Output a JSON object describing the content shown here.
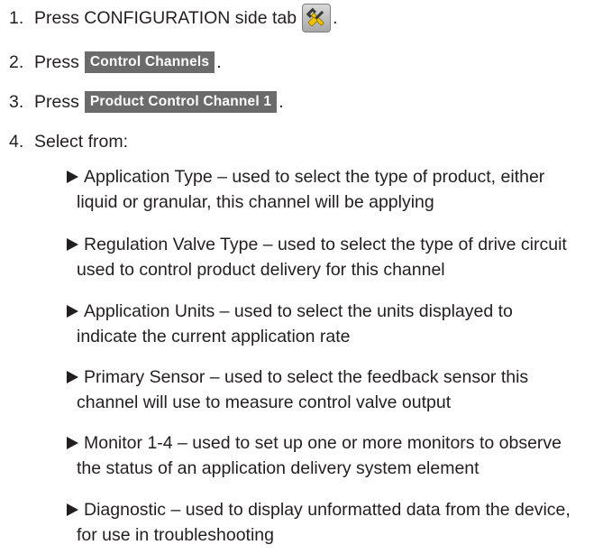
{
  "steps": [
    {
      "num": "1.",
      "text": "Press CONFIGURATION side tab",
      "icon": "configuration-tools-icon",
      "after": "."
    },
    {
      "num": "2.",
      "text": "Press",
      "button": "Control Channels",
      "after": "."
    },
    {
      "num": "3.",
      "text": "Press",
      "button": "Product Control Channel 1",
      "after": "."
    },
    {
      "num": "4.",
      "text": "Select from:"
    }
  ],
  "options": [
    {
      "line1": "Application Type – used to select the type of product, either",
      "line2": "liquid or granular, this channel will be applying"
    },
    {
      "line1": "Regulation Valve Type – used to select the type of drive circuit",
      "line2": "used to control product delivery for this channel"
    },
    {
      "line1": "Application Units – used to select the units displayed to",
      "line2": "indicate the current application rate"
    },
    {
      "line1": "Primary Sensor – used to select the feedback sensor this",
      "line2": "channel will use to measure control valve output"
    },
    {
      "line1": "Monitor 1-4 – used to set up one or more monitors to observe",
      "line2": "the status of an application delivery system element"
    },
    {
      "line1": "Diagnostic – used to display unformatted data from the device,",
      "line2": "for use in troubleshooting"
    }
  ],
  "colors": {
    "text": "#231f20",
    "button_bg": "#6b6b6b",
    "button_text": "#ffffff"
  }
}
